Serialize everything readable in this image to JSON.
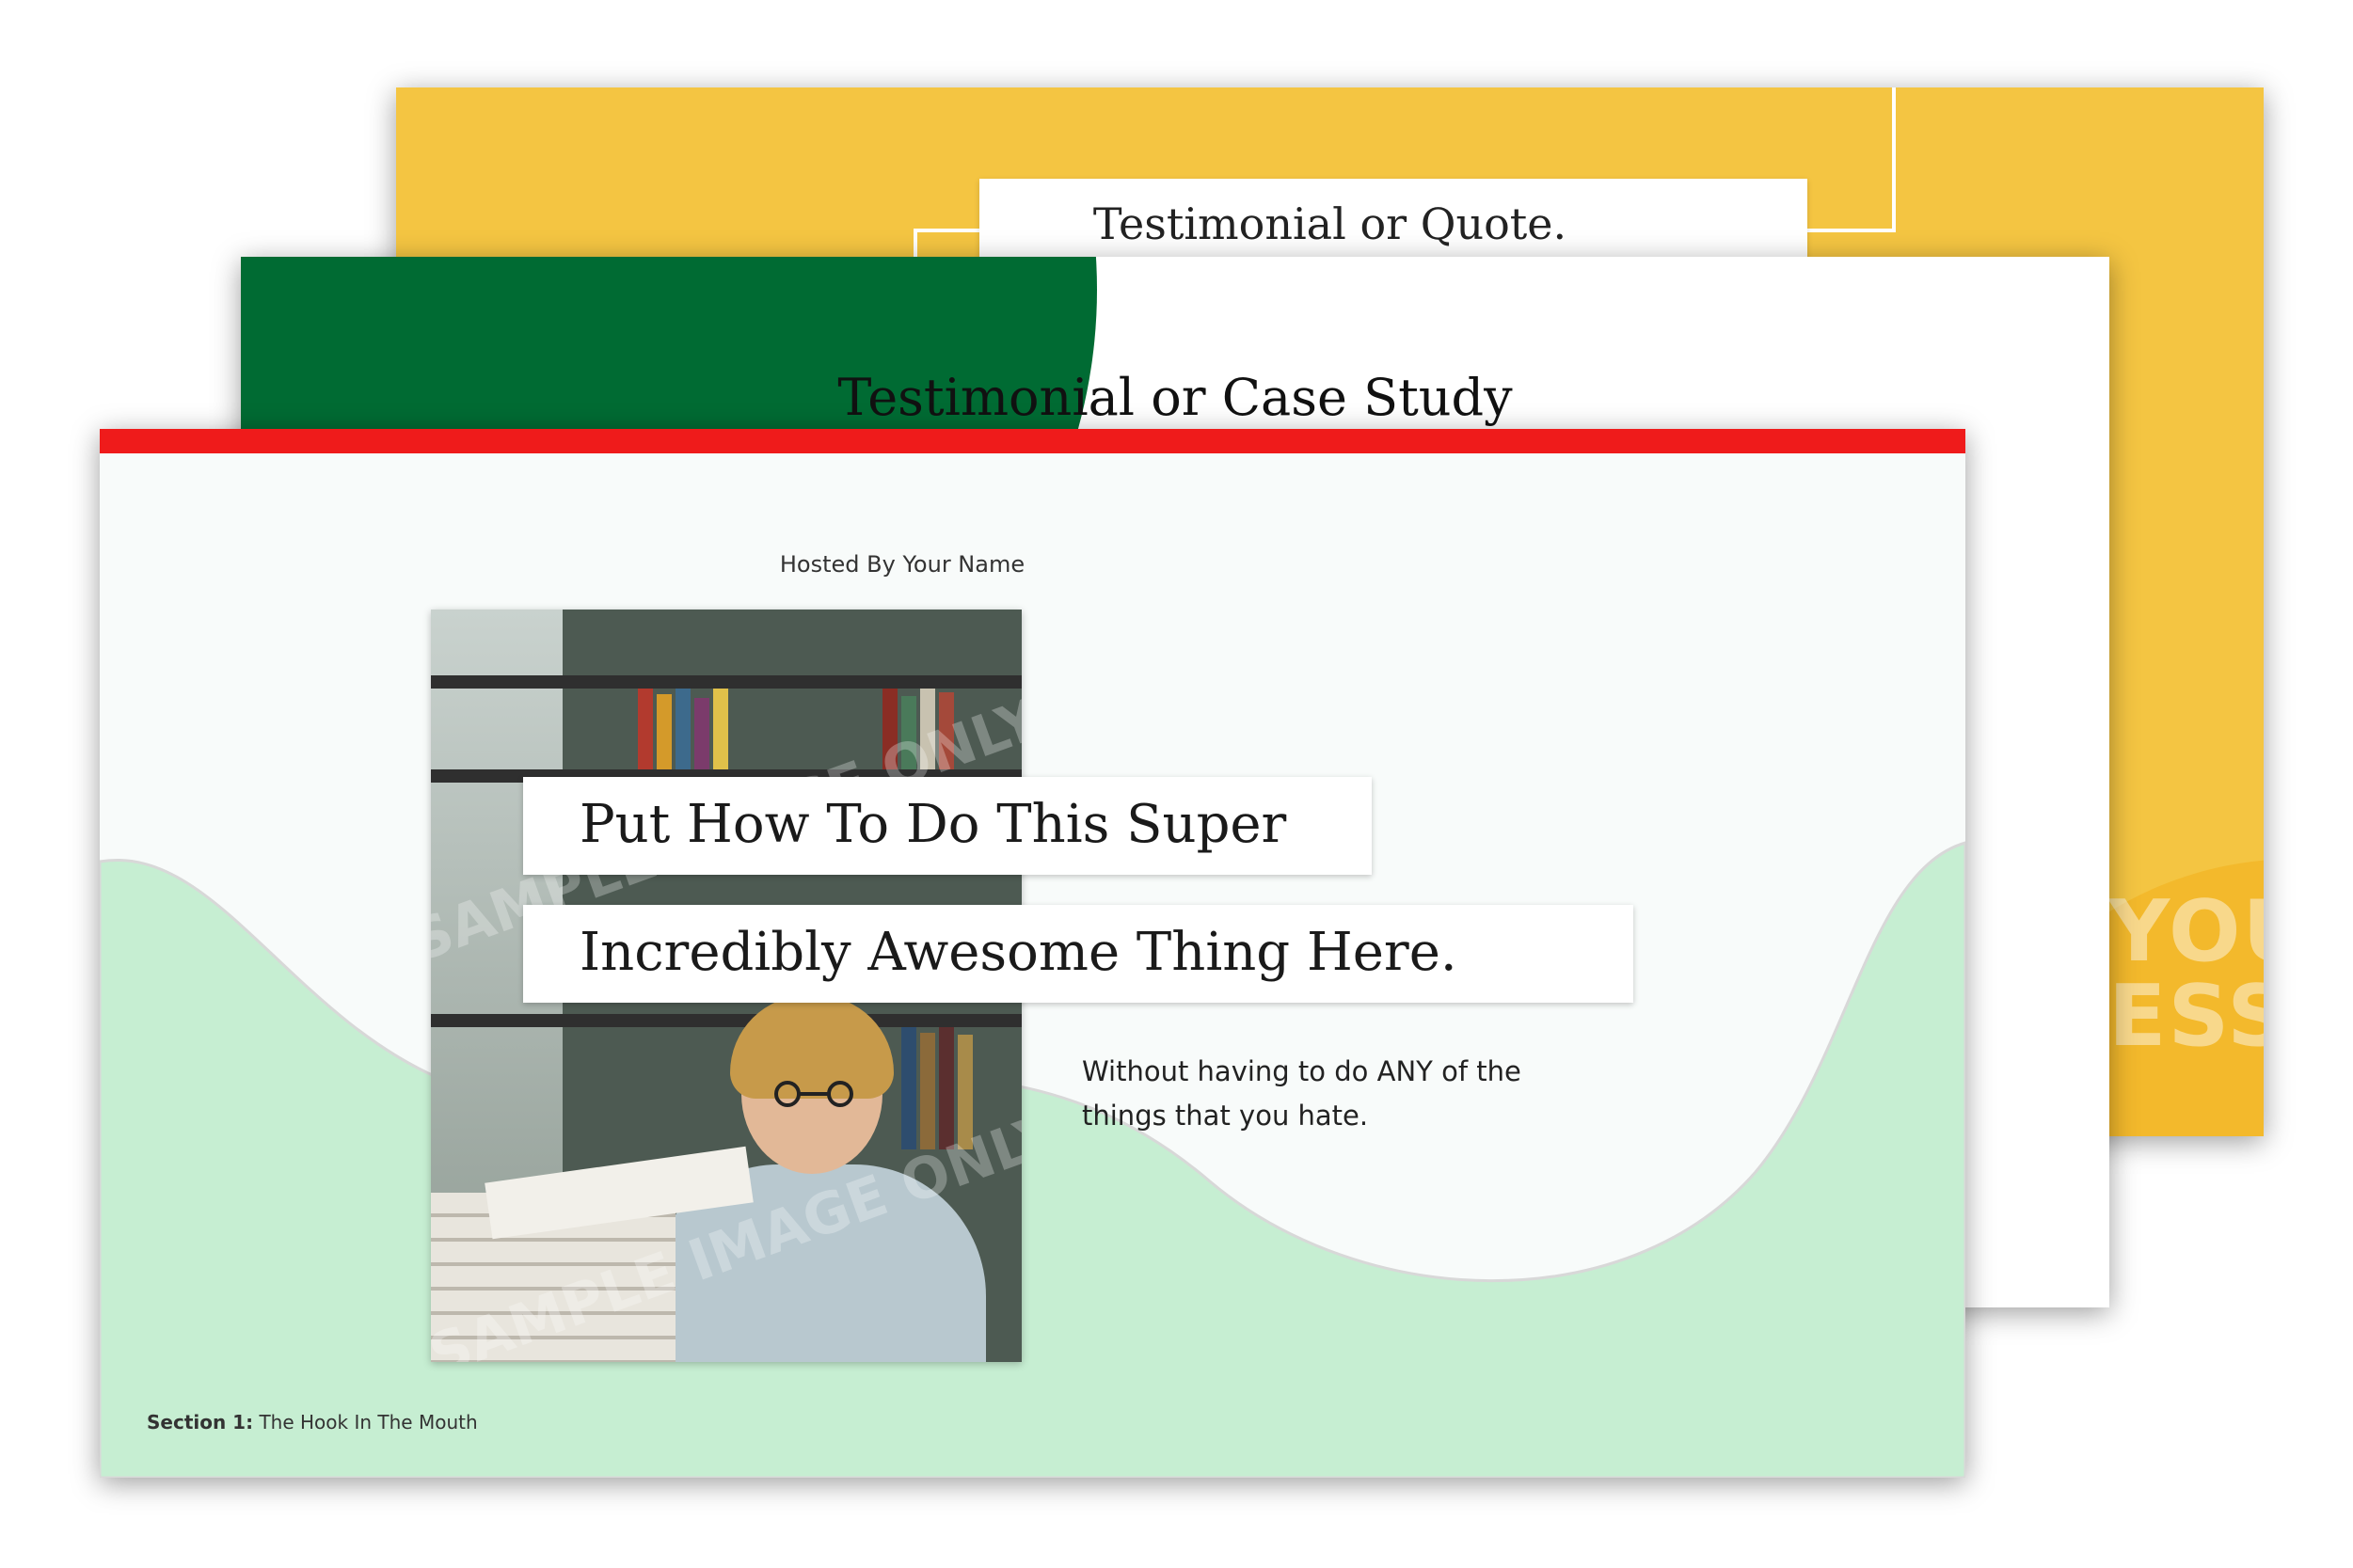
{
  "slides": {
    "back": {
      "title": "Testimonial or Quote.",
      "bg_word_1": "YOU",
      "bg_word_2": "ESS",
      "bg_color": "#f4c542"
    },
    "middle": {
      "title": "Testimonial or Case Study",
      "accent_color": "#006b33"
    },
    "front": {
      "hosted_by": "Hosted By Your Name",
      "headline_line_1": "Put How To Do This Super",
      "headline_line_2": "Incredibly Awesome Thing Here.",
      "subtext": "Without having to do ANY of the things that you hate.",
      "section_prefix": "Section 1:",
      "section_name": " The Hook In The Mouth",
      "photo_watermark": "SAMPLE IMAGE ONLY",
      "top_bar_color": "#ef1b1b",
      "wave_color": "#c6eed2"
    }
  }
}
